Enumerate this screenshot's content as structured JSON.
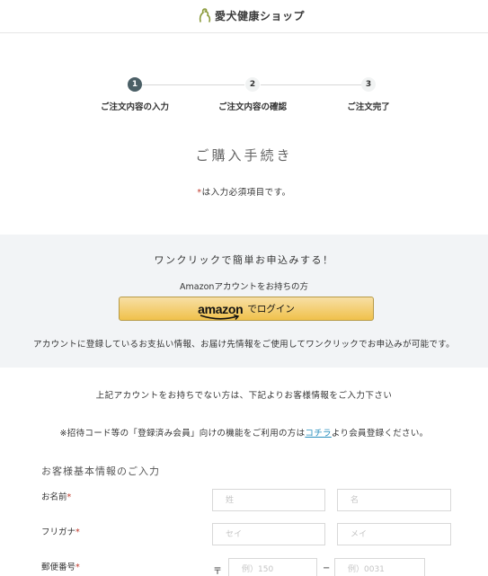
{
  "header": {
    "logo_text": "愛犬健康ショップ",
    "logo_icon": "dog-icon"
  },
  "steps": [
    {
      "number": "1",
      "label": "ご注文内容の入力",
      "active": true
    },
    {
      "number": "2",
      "label": "ご注文内容の確認",
      "active": false
    },
    {
      "number": "3",
      "label": "ご注文完了",
      "active": false
    }
  ],
  "page": {
    "title": "ご購入手続き",
    "required_mark": "*",
    "required_note": "は入力必須項目です。"
  },
  "oneclick": {
    "title": "ワンクリックで簡単お申込みする！",
    "amazon_note": "Amazonアカウントをお持ちの方",
    "amazon_logo": "amazon",
    "amazon_login": "でログイン",
    "description": "アカウントに登録しているお支払い情報、お届け先情報をご使用してワンクリックでお申込みが可能です。"
  },
  "guest": {
    "no_account": "上記アカウントをお持ちでない方は、下記よりお客様情報をご入力下さい",
    "invite_before": "※招待コード等の「登録済み会員」向けの機能をご利用の方は",
    "invite_link": "コチラ",
    "invite_after": "より会員登録ください。"
  },
  "form": {
    "section_title": "お客様基本情報のご入力",
    "name": {
      "label": "お名前",
      "mark": "*",
      "last_placeholder": "姓",
      "first_placeholder": "名"
    },
    "kana": {
      "label": "フリガナ",
      "mark": "*",
      "last_placeholder": "セイ",
      "first_placeholder": "メイ"
    },
    "postal": {
      "label": "郵便番号",
      "mark": "*",
      "prefix": "〒",
      "separator": "−",
      "first_placeholder": "例）150",
      "second_placeholder": "例）0031"
    }
  },
  "colors": {
    "step_active": "#4b5f66",
    "required_mark": "#c0392b",
    "link": "#2a8fbd",
    "amazon_button": "#f0c14b",
    "oneclick_bg": "#f2f4f6"
  }
}
